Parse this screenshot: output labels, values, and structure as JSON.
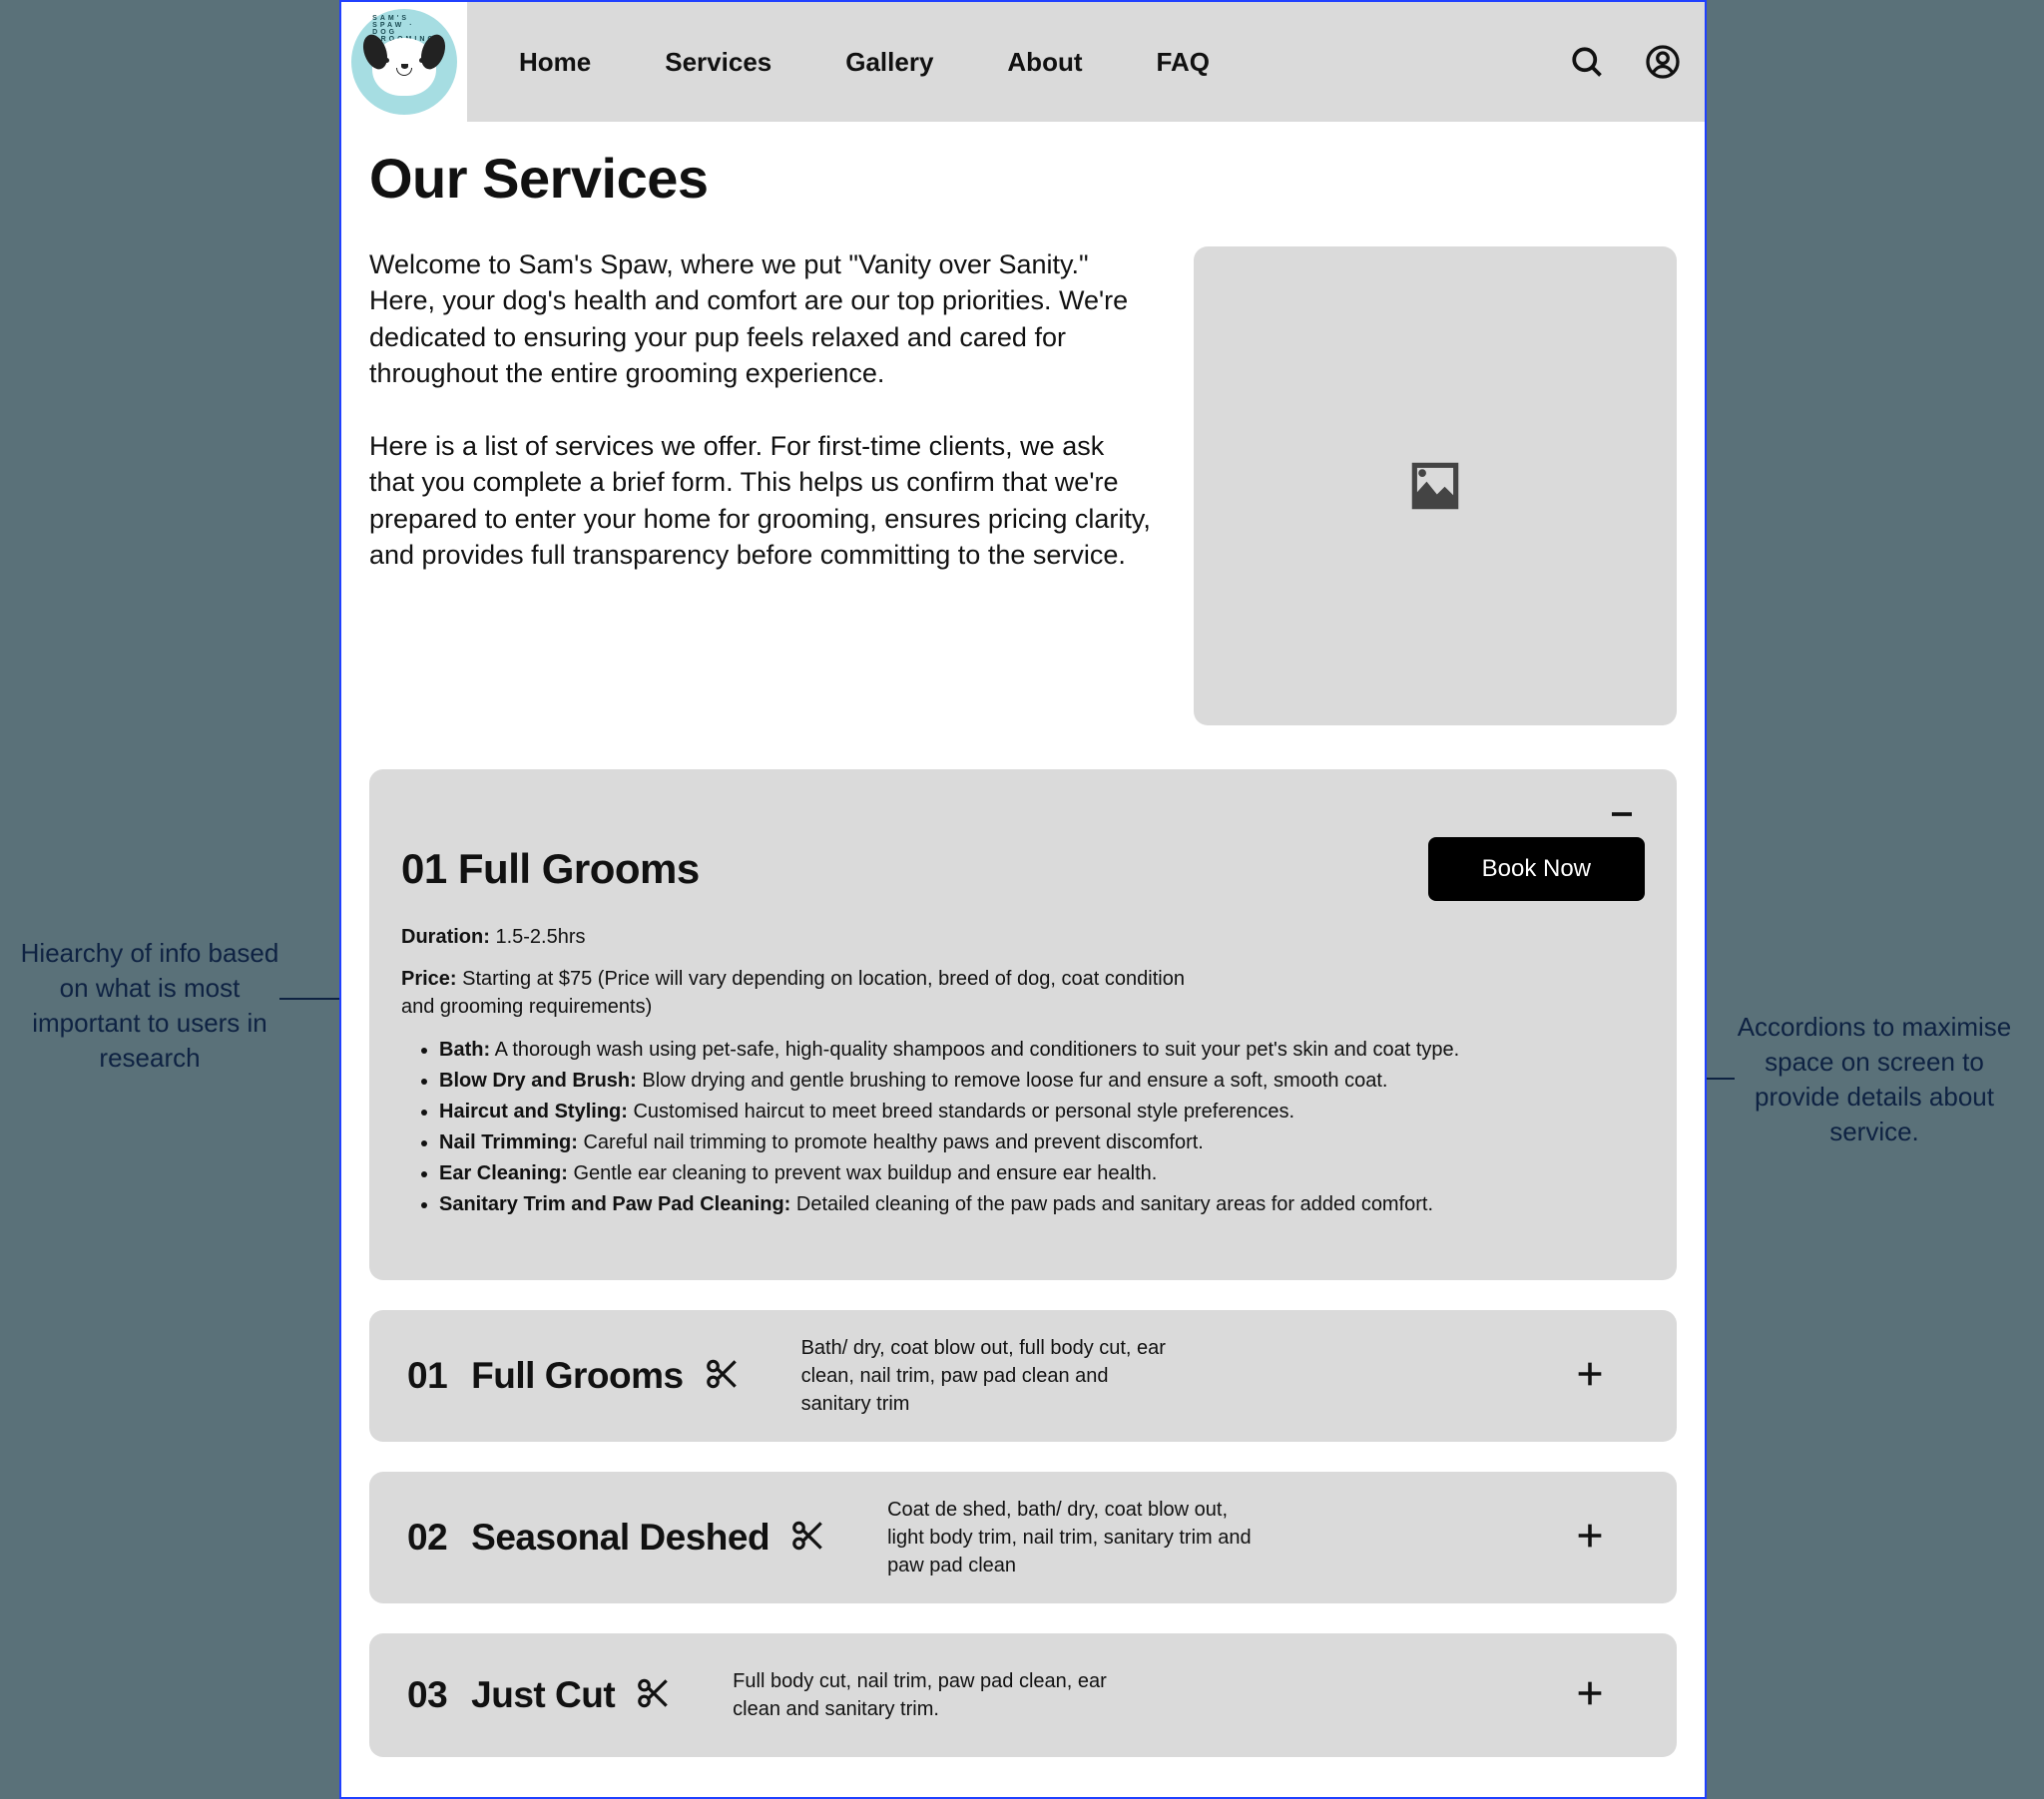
{
  "nav": {
    "items": [
      "Home",
      "Services",
      "Gallery",
      "About",
      "FAQ"
    ]
  },
  "logo": {
    "arc_text": "SAM'S SPAW · DOG GROOMING"
  },
  "page": {
    "title": "Our Services",
    "intro_p1": "Welcome to Sam's Spaw, where we put \"Vanity over Sanity.\" Here, your dog's health and comfort are our top priorities. We're dedicated to ensuring your pup feels relaxed and cared for throughout the entire grooming experience.",
    "intro_p2": "Here is a list of services we offer. For first-time clients, we ask that you complete a brief form. This helps us confirm that we're prepared to enter your home for grooming, ensures pricing clarity, and provides full transparency before committing to the service."
  },
  "expanded": {
    "title": "01 Full Grooms",
    "book_label": "Book Now",
    "duration_label": "Duration:",
    "duration_value": "1.5-2.5hrs",
    "price_label": "Price:",
    "price_value": "Starting at $75 (Price will vary depending on location, breed of dog, coat condition and grooming requirements)",
    "details": [
      {
        "strong": "Bath:",
        "text": " A thorough wash using pet-safe, high-quality shampoos and conditioners to suit your pet's skin and coat type."
      },
      {
        "strong": "Blow Dry and Brush:",
        "text": " Blow drying and gentle brushing to remove loose fur and ensure a soft, smooth coat."
      },
      {
        "strong": "Haircut and Styling:",
        "text": " Customised haircut to meet breed standards or personal style preferences."
      },
      {
        "strong": "Nail Trimming:",
        "text": " Careful nail trimming to promote healthy paws and prevent discomfort."
      },
      {
        "strong": "Ear Cleaning:",
        "text": " Gentle ear cleaning to prevent wax buildup and ensure ear health."
      },
      {
        "strong": "Sanitary Trim and Paw Pad Cleaning:",
        "text": " Detailed cleaning of the paw pads and sanitary areas for added comfort."
      }
    ]
  },
  "accordions": [
    {
      "num": "01",
      "title": "Full Grooms",
      "summary": "Bath/ dry, coat blow out, full body cut, ear clean, nail trim, paw pad clean and sanitary trim"
    },
    {
      "num": "02",
      "title": "Seasonal Deshed",
      "summary": "Coat de shed, bath/ dry, coat blow out, light body trim, nail trim, sanitary trim and paw pad clean"
    },
    {
      "num": "03",
      "title": "Just Cut",
      "summary": "Full body cut, nail trim, paw pad clean, ear clean  and sanitary trim."
    }
  ],
  "annotations": {
    "left": "Hiearchy of info based on what is most important to users in research",
    "right": "Accordions to maximise space on screen to provide details about service."
  }
}
